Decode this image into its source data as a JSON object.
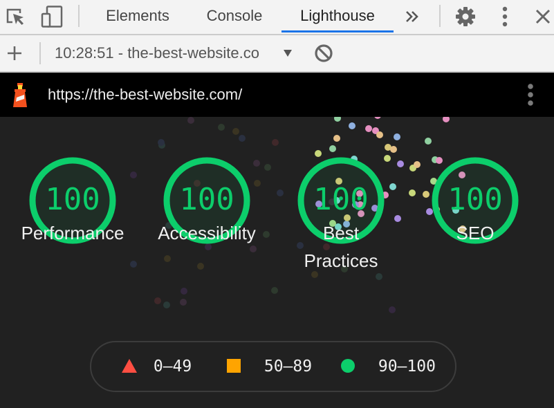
{
  "devtools": {
    "tabs": [
      {
        "label": "Elements",
        "active": false
      },
      {
        "label": "Console",
        "active": false
      },
      {
        "label": "Lighthouse",
        "active": true
      }
    ],
    "icons": {
      "inspect": "inspect-element-icon",
      "device": "device-toolbar-icon",
      "more_tabs": "chevron-double-right-icon",
      "settings": "gear-icon",
      "menu": "kebab-menu-icon",
      "close": "close-icon"
    },
    "accent_color": "#1a73e8"
  },
  "lighthouse_toolbar": {
    "new_report_icon": "plus-icon",
    "report_select_value": "10:28:51 - the-best-website.co",
    "dropdown_icon": "caret-down-icon",
    "clear_icon": "clear-block-icon"
  },
  "report": {
    "url": "https://the-best-website.com/",
    "logo": "lighthouse-logo-icon",
    "menu_icon": "kebab-menu-icon",
    "gauges": [
      {
        "score": "100",
        "label": "Performance"
      },
      {
        "score": "100",
        "label": "Accessibility"
      },
      {
        "score": "100",
        "label": "Best Practices",
        "label_lines": [
          "Best",
          "Practices"
        ]
      },
      {
        "score": "100",
        "label": "SEO"
      }
    ],
    "pass_color": "#0cce6b",
    "legend": [
      {
        "shape": "triangle",
        "range": "0–49",
        "color": "#ff4e42"
      },
      {
        "shape": "square",
        "range": "50–89",
        "color": "#ffa400"
      },
      {
        "shape": "circle",
        "range": "90–100",
        "color": "#0cce6b"
      }
    ]
  }
}
